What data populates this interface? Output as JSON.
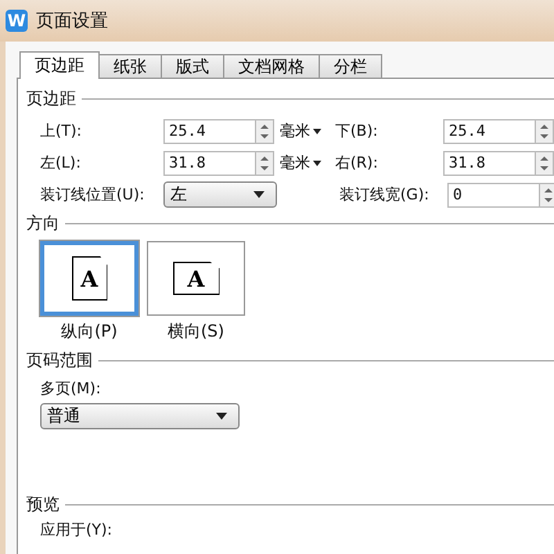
{
  "window": {
    "title": "页面设置",
    "icon_letter": "W"
  },
  "tabs": [
    {
      "label": "页边距",
      "selected": true
    },
    {
      "label": "纸张",
      "selected": false
    },
    {
      "label": "版式",
      "selected": false
    },
    {
      "label": "文档网格",
      "selected": false
    },
    {
      "label": "分栏",
      "selected": false
    }
  ],
  "margins": {
    "title": "页边距",
    "rows": [
      [
        {
          "kind": "spin",
          "label": "上(T):",
          "value": "25.4",
          "unit": "毫米"
        },
        {
          "kind": "spin",
          "label": "下(B):",
          "value": "25.4"
        }
      ],
      [
        {
          "kind": "spin",
          "label": "左(L):",
          "value": "31.8",
          "unit": "毫米"
        },
        {
          "kind": "spin",
          "label": "右(R):",
          "value": "31.8"
        }
      ],
      [
        {
          "kind": "select",
          "label": "装订线位置(U):",
          "value": "左"
        },
        {
          "kind": "spin",
          "label": "装订线宽(G):",
          "value": "0"
        }
      ]
    ]
  },
  "orientation": {
    "title": "方向",
    "options": [
      {
        "kind": "portrait",
        "letter": "A",
        "label": "纵向(P)",
        "selected": true
      },
      {
        "kind": "landscape",
        "letter": "A",
        "label": "横向(S)",
        "selected": false
      }
    ]
  },
  "page_range": {
    "title": "页码范围",
    "label": "多页(M):",
    "value": "普通"
  },
  "preview": {
    "title": "预览",
    "label": "应用于(Y):"
  }
}
